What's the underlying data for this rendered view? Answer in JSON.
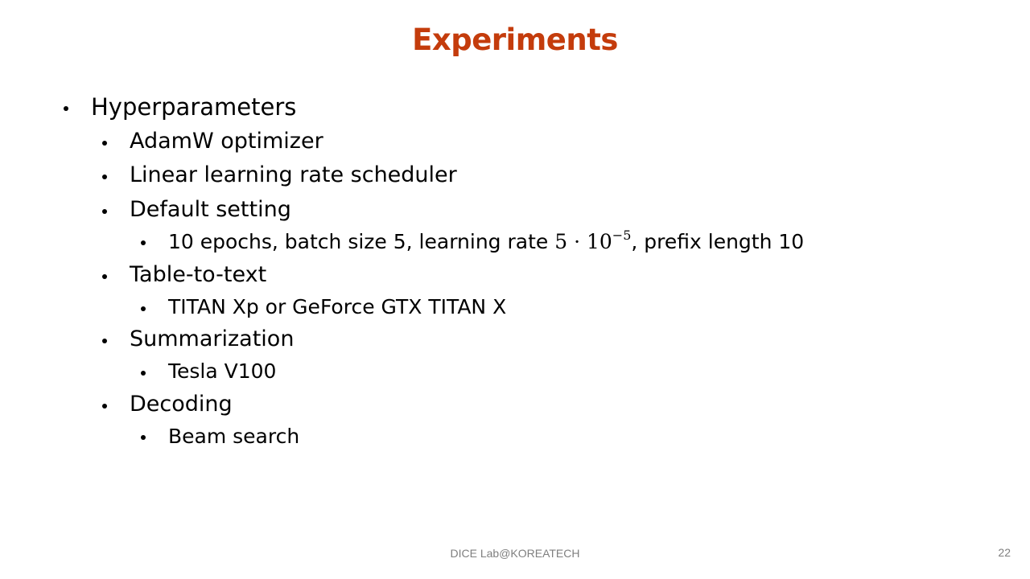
{
  "slide": {
    "title": "Experiments",
    "bullets": {
      "hyperparameters": "Hyperparameters",
      "adamw": "AdamW optimizer",
      "scheduler": "Linear learning rate scheduler",
      "default_setting": "Default setting",
      "default_detail_prefix": "10 epochs, batch size 5, learning rate ",
      "default_detail_math_base": "5 · 10",
      "default_detail_math_exp": "−5",
      "default_detail_suffix": ", prefix length 10",
      "table_to_text": "Table-to-text",
      "table_to_text_gpu": "TITAN Xp or GeForce GTX TITAN X",
      "summarization": "Summarization",
      "summarization_gpu": "Tesla V100",
      "decoding": "Decoding",
      "decoding_method": "Beam search"
    },
    "footer": "DICE  Lab@KOREATECH",
    "page_number": "22",
    "colors": {
      "title": "#c43c0c",
      "footer": "#7f7f7f"
    }
  }
}
